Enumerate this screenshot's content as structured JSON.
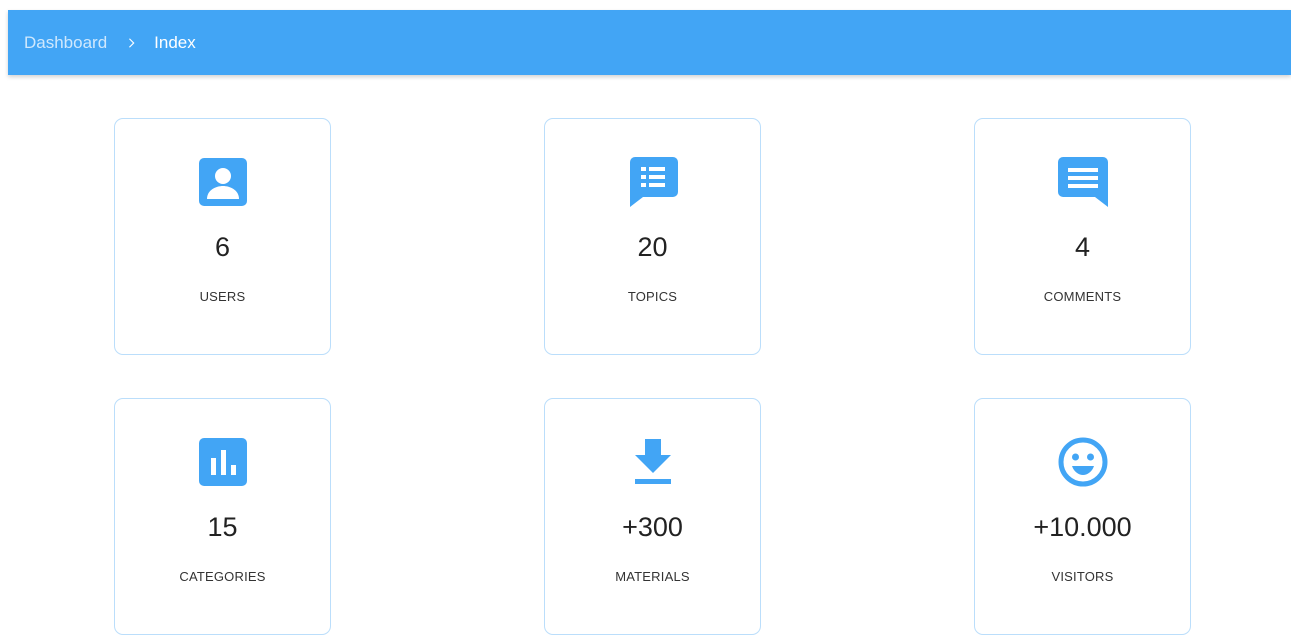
{
  "breadcrumb": {
    "items": [
      {
        "label": "Dashboard"
      },
      {
        "label": "Index"
      }
    ]
  },
  "theme": {
    "accent": "#42a5f5",
    "card_border": "#bbdefb"
  },
  "stats": [
    {
      "icon": "account-box-icon",
      "value": "6",
      "label": "USERS"
    },
    {
      "icon": "topic-list-icon",
      "value": "20",
      "label": "TOPICS"
    },
    {
      "icon": "comment-icon",
      "value": "4",
      "label": "COMMENTS"
    },
    {
      "icon": "bar-chart-icon",
      "value": "15",
      "label": "CATEGORIES"
    },
    {
      "icon": "download-icon",
      "value": "+300",
      "label": "MATERIALS"
    },
    {
      "icon": "smiley-icon",
      "value": "+10.000",
      "label": "VISITORS"
    }
  ]
}
